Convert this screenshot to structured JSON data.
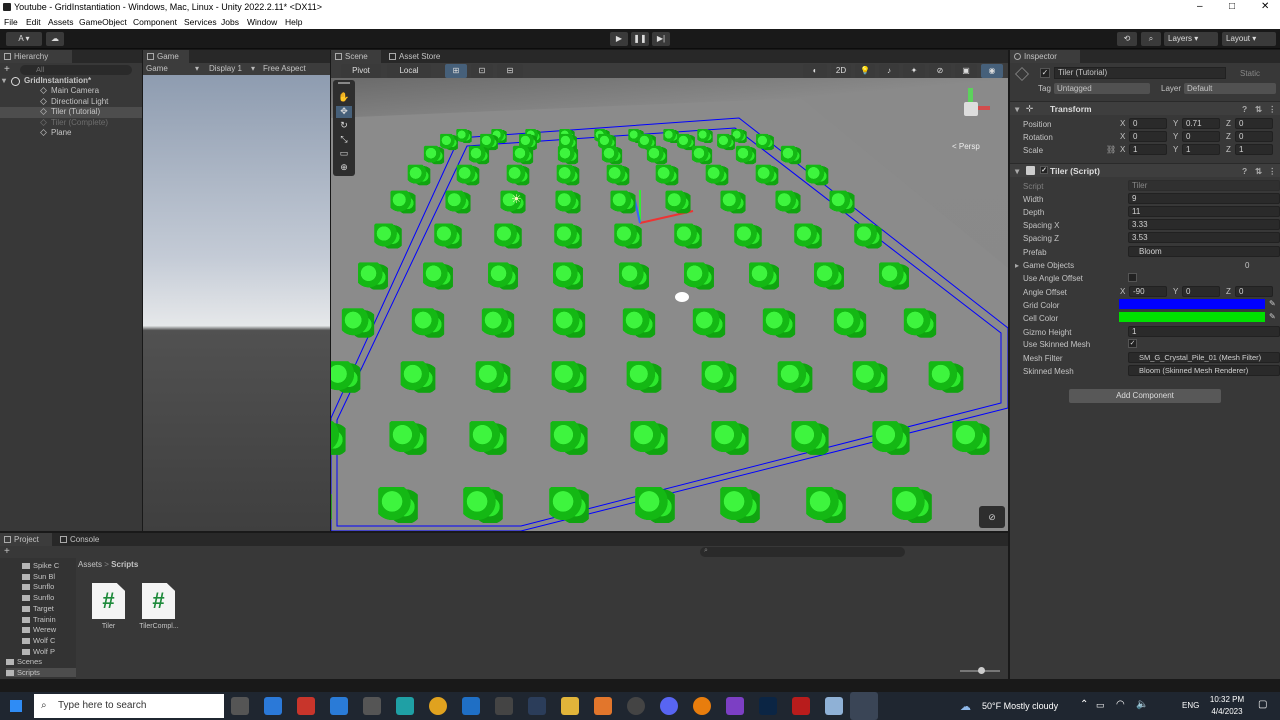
{
  "window": {
    "title": "Youtube - GridInstantiation - Windows, Mac, Linux - Unity 2022.2.11* <DX11>",
    "controls": [
      "–",
      "□",
      "✕"
    ]
  },
  "menu": [
    "File",
    "Edit",
    "Assets",
    "GameObject",
    "Component",
    "Services",
    "Jobs",
    "Window",
    "Help"
  ],
  "toolbar": {
    "account": "A ▾",
    "play_icon": "▶",
    "pause_icon": "❚❚",
    "step_icon": "▶|",
    "layers": "Layers",
    "layout": "Layout"
  },
  "hierarchy": {
    "tab": "Hierarchy",
    "search_placeholder": "All",
    "scene": "GridInstantiation*",
    "items": [
      {
        "label": "Main Camera",
        "state": "normal"
      },
      {
        "label": "Directional Light",
        "state": "normal"
      },
      {
        "label": "Tiler (Tutorial)",
        "state": "selected"
      },
      {
        "label": "Tiler (Complete)",
        "state": "disabled"
      },
      {
        "label": "Plane",
        "state": "normal"
      }
    ]
  },
  "game": {
    "tab": "Game",
    "mode": "Game",
    "display": "Display 1",
    "aspect": "Free Aspect"
  },
  "scene": {
    "tabs": [
      "Scene",
      "Asset Store"
    ],
    "pivot": "Pivot",
    "space": "Local",
    "mode_2d": "2D",
    "persp": "< Persp"
  },
  "inspector": {
    "tab": "Inspector",
    "object_name": "Tiler (Tutorial)",
    "static_label": "Static",
    "tag_label": "Tag",
    "tag": "Untagged",
    "layer_label": "Layer",
    "layer": "Default",
    "transform": {
      "title": "Transform",
      "rows": [
        {
          "label": "Position",
          "x": "0",
          "y": "0.71",
          "z": "0"
        },
        {
          "label": "Rotation",
          "x": "0",
          "y": "0",
          "z": "0"
        },
        {
          "label": "Scale",
          "x": "1",
          "y": "1",
          "z": "1"
        }
      ]
    },
    "tiler": {
      "title": "Tiler (Script)",
      "script_label": "Script",
      "script": "Tiler",
      "width_label": "Width",
      "width": "9",
      "depth_label": "Depth",
      "depth": "11",
      "spacing_x_label": "Spacing X",
      "spacing_x": "3.33",
      "spacing_z_label": "Spacing Z",
      "spacing_z": "3.53",
      "prefab_label": "Prefab",
      "prefab": "Bloom",
      "game_objects_label": "Game Objects",
      "game_objects": "0",
      "use_angle_offset_label": "Use Angle Offset",
      "angle_offset_label": "Angle Offset",
      "angle_offset": {
        "x": "-90",
        "y": "0",
        "z": "0"
      },
      "grid_color_label": "Grid Color",
      "grid_color": "#0000ff",
      "cell_color_label": "Cell Color",
      "cell_color": "#00e000",
      "gizmo_height_label": "Gizmo Height",
      "gizmo_height": "1",
      "use_skinned_mesh_label": "Use Skinned Mesh",
      "mesh_filter_label": "Mesh Filter",
      "mesh_filter": "SM_G_Crystal_Pile_01 (Mesh Filter)",
      "skinned_mesh_label": "Skinned Mesh",
      "skinned_mesh": "Bloom (Skinned Mesh Renderer)"
    },
    "add_component": "Add Component"
  },
  "project": {
    "tabs": [
      "Project",
      "Console"
    ],
    "folders": [
      "Spike C",
      "Sun Bl",
      "Sunflo",
      "Sunflo",
      "Target",
      "Trainin",
      "Werew",
      "Wolf C",
      "Wolf P",
      "Scenes",
      "Scripts"
    ],
    "breadcrumb": [
      "Assets",
      "Scripts"
    ],
    "files": [
      {
        "name": "Tiler",
        "icon": "#"
      },
      {
        "name": "TilerCompl...",
        "icon": "#"
      }
    ]
  },
  "taskbar": {
    "search_placeholder": "Type here to search",
    "weather": "50°F  Mostly cloudy",
    "lang": "ENG",
    "time": "10:32 PM",
    "date": "4/4/2023"
  },
  "colors": {
    "unity_dark": "#383838",
    "selection": "#4d4d4d",
    "grid_blue": "#0000ff",
    "plant_green": "#1fd11f"
  }
}
